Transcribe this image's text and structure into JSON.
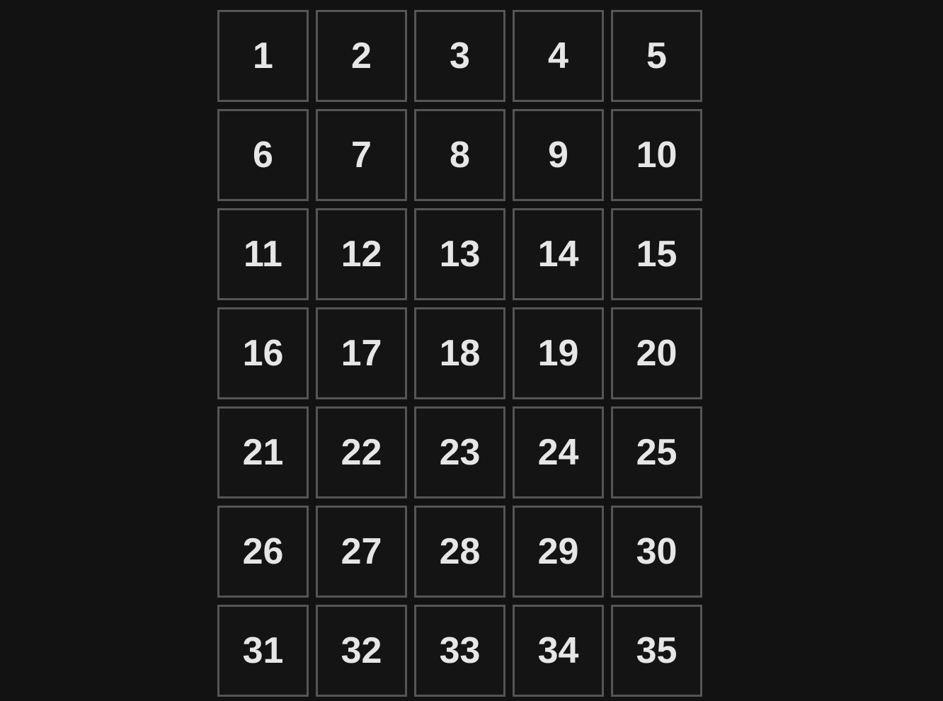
{
  "grid": {
    "cells": [
      "1",
      "2",
      "3",
      "4",
      "5",
      "6",
      "7",
      "8",
      "9",
      "10",
      "11",
      "12",
      "13",
      "14",
      "15",
      "16",
      "17",
      "18",
      "19",
      "20",
      "21",
      "22",
      "23",
      "24",
      "25",
      "26",
      "27",
      "28",
      "29",
      "30",
      "31",
      "32",
      "33",
      "34",
      "35"
    ]
  },
  "colors": {
    "background": "#121212",
    "cell_background": "#141414",
    "cell_border": "#555555",
    "text": "#e6e6e6"
  }
}
